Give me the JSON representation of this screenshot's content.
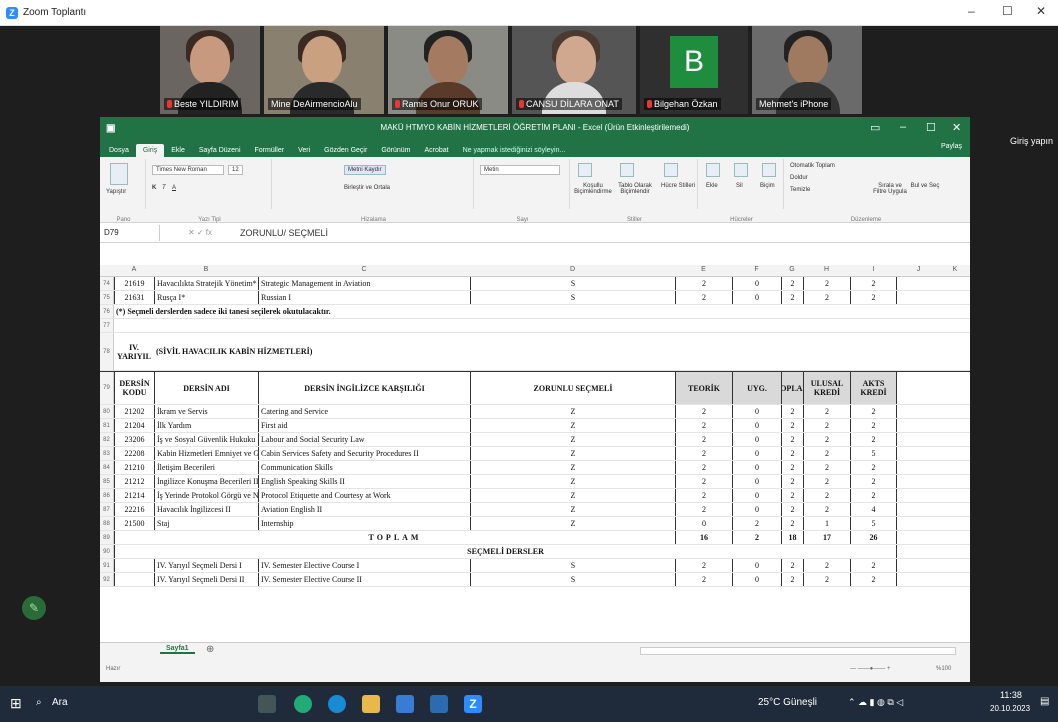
{
  "zoom": {
    "title": "Zoom Toplantı",
    "signin": "Giriş yapın"
  },
  "participants": [
    {
      "name": "Beste YILDIRIM",
      "muted": true
    },
    {
      "name": "Mine DeAirmencioAlu",
      "muted": false
    },
    {
      "name": "Ramis Onur ORUK",
      "muted": true
    },
    {
      "name": "CANSU DİLARA ONAT",
      "muted": true
    },
    {
      "name": "Bilgehan Özkan",
      "muted": true,
      "initial": "B"
    },
    {
      "name": "Mehmet's iPhone",
      "muted": false
    }
  ],
  "excel": {
    "title": "MAKÜ HTMYO KABİN HİZMETLERİ ÖĞRETİM PLANI - Excel (Ürün Etkinleştirilemedi)",
    "tabs": [
      "Dosya",
      "Giriş",
      "Ekle",
      "Sayfa Düzeni",
      "Formüller",
      "Veri",
      "Gözden Geçir",
      "Görünüm",
      "Acrobat",
      "Ne yapmak istediğinizi söyleyin..."
    ],
    "share": "Paylaş",
    "ribbon": {
      "paste": "Yapıştır",
      "clipboard": "Pano",
      "font_name": "Times New Roman",
      "font_size": "12",
      "font_group": "Yazı Tipi",
      "wrap": "Metni Kaydır",
      "merge": "Birleştir ve Ortala",
      "align_group": "Hizalama",
      "number_format": "Metin",
      "number_group": "Sayı",
      "cond_format": "Koşullu Biçimlendirme",
      "table_format": "Tablo Olarak Biçimlendir",
      "cell_styles": "Hücre Stilleri",
      "styles_group": "Stiller",
      "insert": "Ekle",
      "delete": "Sil",
      "format": "Biçim",
      "cells_group": "Hücreler",
      "autosum": "Otomatik Toplam",
      "fill": "Doldur",
      "clear": "Temizle",
      "sort": "Sırala ve Filtre Uygula",
      "find": "Bul ve Seç",
      "edit_group": "Düzenleme"
    },
    "name_box": "D79",
    "formula": "ZORUNLU/ SEÇMELİ",
    "columns": [
      "A",
      "B",
      "C",
      "D",
      "E",
      "F",
      "G",
      "H",
      "I",
      "J",
      "K",
      "L"
    ],
    "rows": [
      {
        "n": "74",
        "cells": [
          "21619",
          "Havacılıkta Stratejik Yönetim*",
          "Strategic Management in Aviation",
          "S",
          "2",
          "0",
          "2",
          "2",
          "2"
        ]
      },
      {
        "n": "75",
        "cells": [
          "21631",
          "Rusça I*",
          "Russian I",
          "S",
          "2",
          "0",
          "2",
          "2",
          "2"
        ]
      },
      {
        "n": "76",
        "note": "(*) Seçmeli derslerden sadece iki tanesi seçilerek okutulacaktır."
      },
      {
        "n": "77"
      },
      {
        "n": "78",
        "sem": "IV. YARIYIL",
        "title": "(SİVİL HAVACILIK KABİN HİZMETLERİ)"
      },
      {
        "n": "79",
        "header": [
          "DERSİN KODU",
          "DERSİN ADI",
          "DERSİN İNGİLİZCE KARŞILIĞI",
          "ZORUNLU SEÇMELİ",
          "TEORİK",
          "UYG.",
          "TOPLAM",
          "ULUSAL KREDİ",
          "AKTS KREDİ"
        ]
      },
      {
        "n": "80",
        "cells": [
          "21202",
          "İkram ve Servis",
          "Catering and Service",
          "Z",
          "2",
          "0",
          "2",
          "2",
          "2"
        ]
      },
      {
        "n": "81",
        "cells": [
          "21204",
          "İlk Yardım",
          "First aid",
          "Z",
          "2",
          "0",
          "2",
          "2",
          "2"
        ]
      },
      {
        "n": "82",
        "cells": [
          "23206",
          "İş ve Sosyal Güvenlik Hukuku",
          "Labour and Social Security Law",
          "Z",
          "2",
          "0",
          "2",
          "2",
          "2"
        ]
      },
      {
        "n": "83",
        "cells": [
          "22208",
          "Kabin Hizmetleri Emniyet ve Güvenlik Prosedürleri II",
          "Cabin Services Safety and Security Procedures II",
          "Z",
          "2",
          "0",
          "2",
          "2",
          "5"
        ]
      },
      {
        "n": "84",
        "cells": [
          "21210",
          "İletişim Becerileri",
          "Communication Skills",
          "Z",
          "2",
          "0",
          "2",
          "2",
          "2"
        ]
      },
      {
        "n": "85",
        "cells": [
          "21212",
          "İngilizce Konuşma Becerileri II",
          "English Speaking Skills II",
          "Z",
          "2",
          "0",
          "2",
          "2",
          "2"
        ]
      },
      {
        "n": "86",
        "cells": [
          "21214",
          "İş Yerinde Protokol Görgü ve Nezaket",
          "Protocol Etiquette and Courtesy at Work",
          "Z",
          "2",
          "0",
          "2",
          "2",
          "2"
        ]
      },
      {
        "n": "87",
        "cells": [
          "22216",
          "Havacılık İngilizcesi II",
          "Aviation English II",
          "Z",
          "2",
          "0",
          "2",
          "2",
          "4"
        ]
      },
      {
        "n": "88",
        "cells": [
          "21500",
          "Staj",
          "Internship",
          "Z",
          "0",
          "2",
          "2",
          "1",
          "5"
        ]
      },
      {
        "n": "89",
        "total": "TOPLAM",
        "totals": [
          "16",
          "2",
          "18",
          "17",
          "26"
        ]
      },
      {
        "n": "90",
        "section": "SEÇMELİ DERSLER"
      },
      {
        "n": "91",
        "cells": [
          "",
          "IV. Yarıyıl Seçmeli Dersi I",
          "IV. Semester Elective Course I",
          "S",
          "2",
          "0",
          "2",
          "2",
          "2"
        ]
      },
      {
        "n": "92",
        "cells": [
          "",
          "IV. Yarıyıl Seçmeli Dersi II",
          "IV. Semester Elective Course II",
          "S",
          "2",
          "0",
          "2",
          "2",
          "2"
        ]
      }
    ],
    "sheet": "Sayfa1",
    "status": "Hazır",
    "zoom_level": "%100"
  },
  "taskbar": {
    "search": "Ara",
    "weather": "25°C Güneşli",
    "time": "11:38",
    "date": "20.10.2023"
  }
}
